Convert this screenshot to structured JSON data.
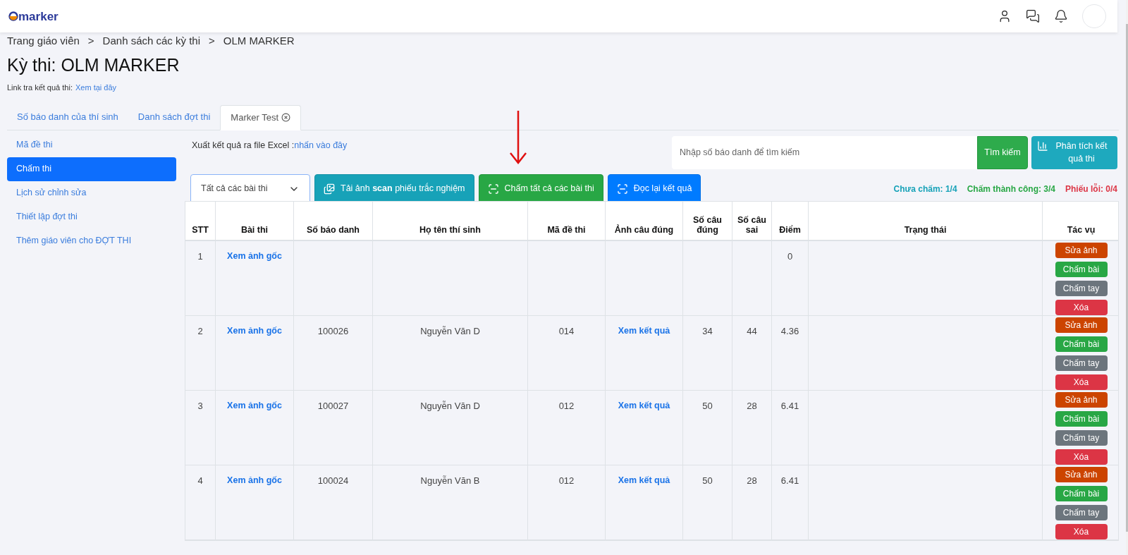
{
  "header": {
    "logo": "marker"
  },
  "breadcrumb": [
    "Trang giáo viên",
    ">",
    "Danh sách các kỳ thi",
    ">",
    "OLM MARKER"
  ],
  "title": "Kỳ thi: OLM MARKER",
  "result_link": {
    "label": "Link tra kết quả thi:",
    "link": "Xem tại đây"
  },
  "tabs": [
    {
      "label": "Số báo danh của thí sinh",
      "selected": false,
      "closable": false
    },
    {
      "label": "Danh sách đợt thi",
      "selected": false,
      "closable": false
    },
    {
      "label": "Marker Test",
      "selected": true,
      "closable": true
    }
  ],
  "sidebar": {
    "items": [
      {
        "label": "Mã đề thi",
        "selected": false
      },
      {
        "label": "Chấm thi",
        "selected": true
      },
      {
        "label": "Lịch sử chỉnh sửa",
        "selected": false
      },
      {
        "label": "Thiết lập đợt thi",
        "selected": false
      },
      {
        "label": "Thêm giáo viên cho ĐỢT THI",
        "selected": false
      }
    ]
  },
  "export": {
    "label": "Xuất kết quả ra file Excel :",
    "link": "nhấn vào đây"
  },
  "search": {
    "placeholder": "Nhập số báo danh để tìm kiếm",
    "button": "Tìm kiếm"
  },
  "analyze_button": "Phân tích kết quả thi",
  "filter_select": {
    "value": "Tất cả các bài thi"
  },
  "action_buttons": [
    {
      "label": "Tải ảnh **scan** phiếu trắc nghiệm",
      "kind": "upload"
    },
    {
      "label": "Chấm tất cả các bài thi",
      "kind": "grade"
    },
    {
      "label": "Đọc lại kết quả",
      "kind": "reread"
    }
  ],
  "stats": [
    {
      "label": "Chưa chấm: 1/4",
      "color": "#17a2b8"
    },
    {
      "label": "Chấm thành công: 3/4",
      "color": "#28a745"
    },
    {
      "label": "Phiếu lỗi: 0/4",
      "color": "#dc3545"
    }
  ],
  "table": {
    "columns": [
      "STT",
      "Bài thi",
      "Số báo danh",
      "Họ tên thí sinh",
      "Mã đề thi",
      "Ảnh câu đúng",
      "Số câu đúng",
      "Số câu sai",
      "Điểm",
      "Trạng thái",
      "Tác vụ"
    ],
    "rows": [
      {
        "stt": "1",
        "exam": "Xem ảnh gốc",
        "score": "0",
        "actions": [
          {
            "label": "Sửa ảnh",
            "kind": "edit"
          },
          {
            "label": "Chấm bài",
            "kind": "grade"
          },
          {
            "label": "Chấm tay",
            "kind": "manual"
          },
          {
            "label": "Xóa",
            "kind": "delete"
          }
        ]
      },
      {
        "stt": "2",
        "exam": "Xem ảnh gốc",
        "candidate_no": "100026",
        "name": "Nguyễn Văn D",
        "code": "014",
        "result": "Xem kết quả",
        "correct": "34",
        "wrong": "44",
        "score": "4.36",
        "actions": [
          {
            "label": "Sửa ảnh",
            "kind": "edit"
          },
          {
            "label": "Chấm bài",
            "kind": "grade"
          },
          {
            "label": "Chấm tay",
            "kind": "manual"
          },
          {
            "label": "Xóa",
            "kind": "delete"
          }
        ]
      },
      {
        "stt": "3",
        "exam": "Xem ảnh gốc",
        "candidate_no": "100027",
        "name": "Nguyễn Văn D",
        "code": "012",
        "result": "Xem kết quả",
        "correct": "50",
        "wrong": "28",
        "score": "6.41",
        "actions": [
          {
            "label": "Sửa ảnh",
            "kind": "edit"
          },
          {
            "label": "Chấm bài",
            "kind": "grade"
          },
          {
            "label": "Chấm tay",
            "kind": "manual"
          },
          {
            "label": "Xóa",
            "kind": "delete"
          }
        ]
      },
      {
        "stt": "4",
        "exam": "Xem ảnh gốc",
        "candidate_no": "100024",
        "name": "Nguyễn Văn B",
        "code": "012",
        "result": "Xem kết quả",
        "correct": "50",
        "wrong": "28",
        "score": "6.41",
        "actions": [
          {
            "label": "Sửa ảnh",
            "kind": "edit"
          },
          {
            "label": "Chấm bài",
            "kind": "grade"
          },
          {
            "label": "Chấm tay",
            "kind": "manual"
          },
          {
            "label": "Xóa",
            "kind": "delete"
          }
        ]
      }
    ]
  }
}
